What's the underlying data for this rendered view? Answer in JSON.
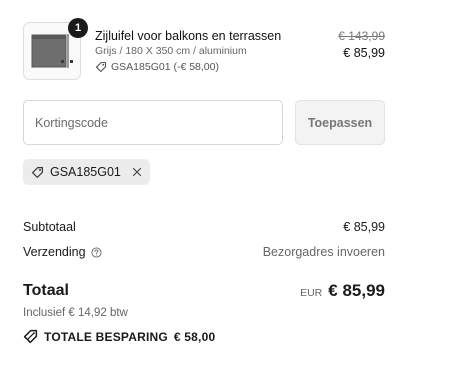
{
  "product": {
    "quantity": "1",
    "title": "Zijluifel voor balkons en terrassen",
    "variant": "Grijs / 180 X 350 cm / aluminium",
    "discount_code": "GSA185G01 (-€ 58,00)",
    "original_price": "€ 143,99",
    "price": "€ 85,99",
    "image_icon": "awning-product-image"
  },
  "discount": {
    "placeholder": "Kortingscode",
    "apply_label": "Toepassen",
    "applied_code": "GSA185G01",
    "remove_icon": "close-icon"
  },
  "summary": {
    "subtotal_label": "Subtotaal",
    "subtotal_value": "€ 85,99",
    "shipping_label": "Verzending",
    "shipping_value": "Bezorgadres invoeren",
    "total_label": "Totaal",
    "currency": "EUR",
    "total_value": "€ 85,99",
    "tax_note": "Inclusief € 14,92 btw",
    "savings_label": "TOTALE BESPARING",
    "savings_value": "€ 58,00"
  },
  "colors": {
    "text": "#1a1a1a",
    "muted": "#666666",
    "chip_bg": "#ececec",
    "button_bg": "#f3f3f3"
  }
}
